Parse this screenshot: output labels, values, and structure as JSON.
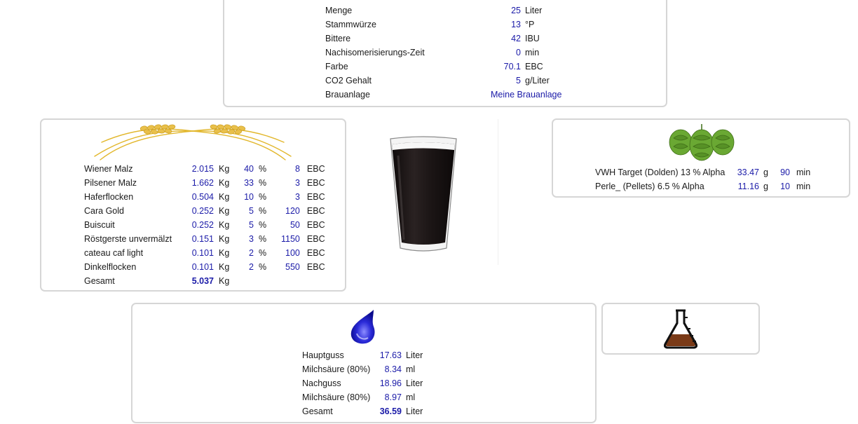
{
  "params": {
    "rows": [
      {
        "label": "Menge",
        "value": "25",
        "unit": "Liter"
      },
      {
        "label": "Stammwürze",
        "value": "13",
        "unit": "°P"
      },
      {
        "label": "Bittere",
        "value": "42",
        "unit": "IBU"
      },
      {
        "label": "Nachisomerisierungs-Zeit",
        "value": "0",
        "unit": "min"
      },
      {
        "label": "Farbe",
        "value": "70.1",
        "unit": "EBC"
      },
      {
        "label": "CO2 Gehalt",
        "value": "5",
        "unit": "g/Liter"
      }
    ],
    "brewery_label": "Brauanlage",
    "brewery_link": "Meine Brauanlage"
  },
  "malt": {
    "icon": "wheat-ears-icon",
    "rows": [
      {
        "name": "Wiener Malz",
        "amount": "2.015",
        "amount_unit": "Kg",
        "percent": "40",
        "percent_unit": "%",
        "ebc": "8",
        "ebc_unit": "EBC"
      },
      {
        "name": "Pilsener Malz",
        "amount": "1.662",
        "amount_unit": "Kg",
        "percent": "33",
        "percent_unit": "%",
        "ebc": "3",
        "ebc_unit": "EBC"
      },
      {
        "name": "Haferflocken",
        "amount": "0.504",
        "amount_unit": "Kg",
        "percent": "10",
        "percent_unit": "%",
        "ebc": "3",
        "ebc_unit": "EBC"
      },
      {
        "name": "Cara Gold",
        "amount": "0.252",
        "amount_unit": "Kg",
        "percent": "5",
        "percent_unit": "%",
        "ebc": "120",
        "ebc_unit": "EBC"
      },
      {
        "name": "Buiscuit",
        "amount": "0.252",
        "amount_unit": "Kg",
        "percent": "5",
        "percent_unit": "%",
        "ebc": "50",
        "ebc_unit": "EBC"
      },
      {
        "name": "Röstgerste unvermälzt",
        "amount": "0.151",
        "amount_unit": "Kg",
        "percent": "3",
        "percent_unit": "%",
        "ebc": "1150",
        "ebc_unit": "EBC"
      },
      {
        "name": "cateau caf light",
        "amount": "0.101",
        "amount_unit": "Kg",
        "percent": "2",
        "percent_unit": "%",
        "ebc": "100",
        "ebc_unit": "EBC"
      },
      {
        "name": "Dinkelflocken",
        "amount": "0.101",
        "amount_unit": "Kg",
        "percent": "2",
        "percent_unit": "%",
        "ebc": "550",
        "ebc_unit": "EBC"
      }
    ],
    "total_label": "Gesamt",
    "total_value": "5.037",
    "total_unit": "Kg"
  },
  "glass": {
    "icon": "beer-glass-icon",
    "color": "#1c1616"
  },
  "hops": {
    "icon": "hop-cones-icon",
    "rows": [
      {
        "name": "VWH Target (Dolden) 13 % Alpha",
        "amount": "33.47",
        "amount_unit": "g",
        "time": "90",
        "time_unit": "min"
      },
      {
        "name": "Perle_ (Pellets) 6.5 % Alpha",
        "amount": "11.16",
        "amount_unit": "g",
        "time": "10",
        "time_unit": "min"
      }
    ]
  },
  "water": {
    "icon": "water-drop-icon",
    "rows": [
      {
        "label": "Hauptguss",
        "value": "17.63",
        "unit": "Liter"
      },
      {
        "label": "Milchsäure (80%)",
        "value": "8.34",
        "unit": "ml"
      },
      {
        "label": "Nachguss",
        "value": "18.96",
        "unit": "Liter"
      },
      {
        "label": "Milchsäure (80%)",
        "value": "8.97",
        "unit": "ml"
      }
    ],
    "total_label": "Gesamt",
    "total_value": "36.59",
    "total_unit": "Liter"
  },
  "yeast": {
    "icon": "erlenmeyer-flask-icon"
  },
  "colors": {
    "value_blue": "#1b1ba8",
    "panel_border": "#d6d6d6",
    "wheat_gold": "#e2b72c",
    "hop_green": "#5e9b2a",
    "water_blue": "#2020c8",
    "wort_brown": "#7a3a17"
  }
}
